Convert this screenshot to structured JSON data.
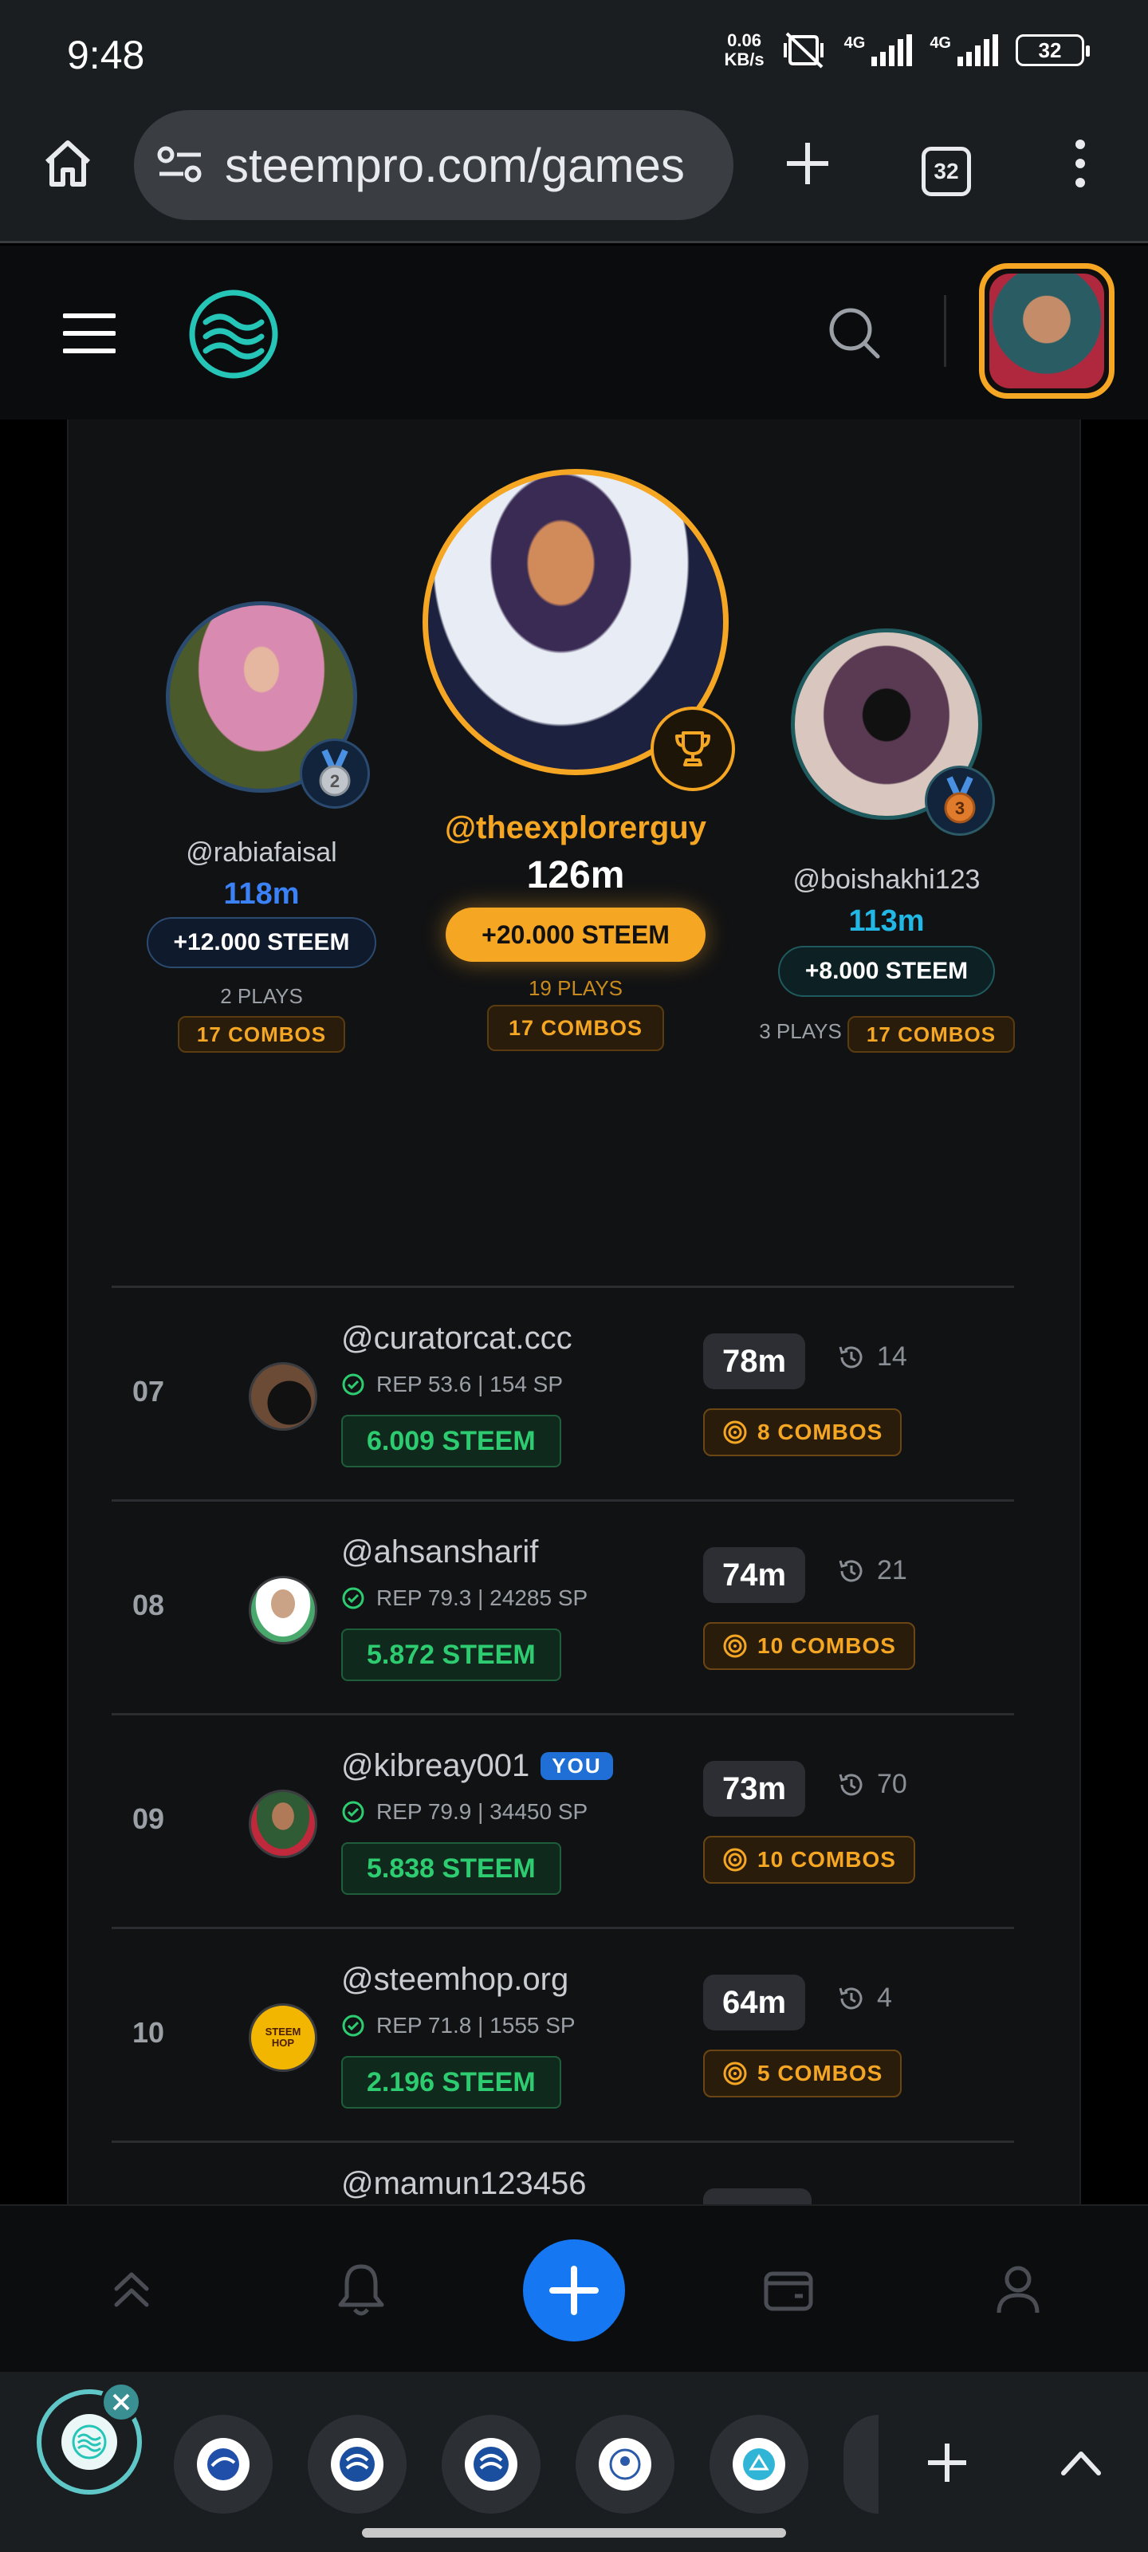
{
  "status_bar": {
    "time": "9:48",
    "net_speed_value": "0.06",
    "net_speed_unit": "KB/s",
    "signal_label_1": "4G",
    "signal_label_2": "4G",
    "battery": "32"
  },
  "browser": {
    "url": "steempro.com/games",
    "tab_count": "32"
  },
  "podium": {
    "first": {
      "username": "@theexplorerguy",
      "distance": "126m",
      "reward": "+20.000 STEEM",
      "plays": "19 PLAYS",
      "combos": "17 COMBOS"
    },
    "second": {
      "username": "@rabiafaisal",
      "distance": "118m",
      "reward": "+12.000 STEEM",
      "plays": "2 PLAYS",
      "combos": "17 COMBOS",
      "medal": "2"
    },
    "third": {
      "username": "@boishakhi123",
      "distance": "113m",
      "reward": "+8.000 STEEM",
      "plays": "3 PLAYS",
      "combos": "17 COMBOS",
      "medal": "3"
    }
  },
  "leaderboard": [
    {
      "rank": "07",
      "username": "@curatorcat.ccc",
      "rep": "REP 53.6 | 154 SP",
      "steem": "6.009 STEEM",
      "distance": "78m",
      "plays": "14",
      "combos": "8 COMBOS"
    },
    {
      "rank": "08",
      "username": "@ahsansharif",
      "rep": "REP 79.3 | 24285 SP",
      "steem": "5.872 STEEM",
      "distance": "74m",
      "plays": "21",
      "combos": "10 COMBOS"
    },
    {
      "rank": "09",
      "username": "@kibreay001",
      "you_badge": "YOU",
      "rep": "REP 79.9 | 34450 SP",
      "steem": "5.838 STEEM",
      "distance": "73m",
      "plays": "70",
      "combos": "10 COMBOS"
    },
    {
      "rank": "10",
      "username": "@steemhop.org",
      "rep": "REP 71.8 | 1555 SP",
      "steem": "2.196 STEEM",
      "distance": "64m",
      "plays": "4",
      "combos": "5 COMBOS",
      "avatar_text": "STEEM HOP"
    },
    {
      "rank": "",
      "username": "@mamun123456"
    }
  ],
  "colors": {
    "accent_orange": "#f5a623",
    "accent_blue": "#3b82f6",
    "accent_cyan": "#22b8e6",
    "green": "#2ecc71",
    "fab_blue": "#1677f2"
  }
}
